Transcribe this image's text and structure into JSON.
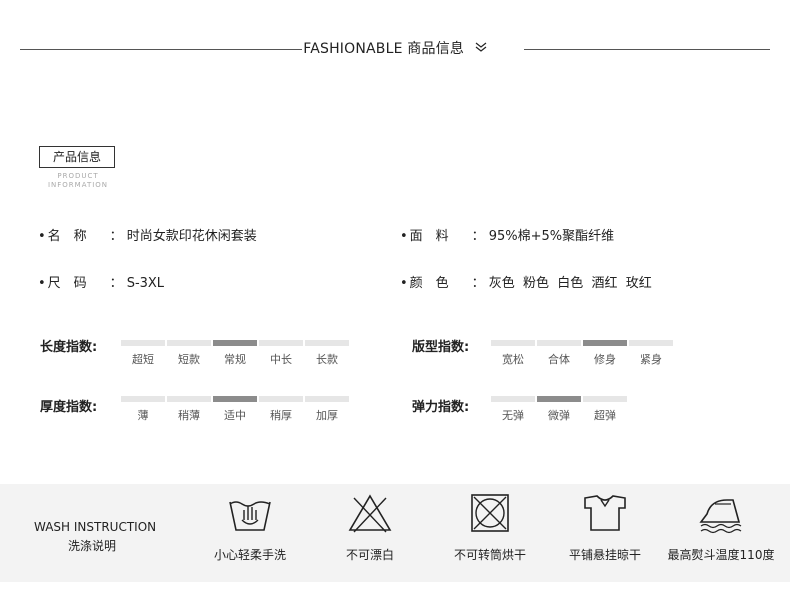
{
  "header": {
    "title": "FASHIONABLE 商品信息",
    "icon": "double-chevron-down-icon"
  },
  "badge": {
    "label": "产品信息",
    "en_line1": "PRODUCT",
    "en_line2": "INFORMATION"
  },
  "info": {
    "name": {
      "key": "名　称",
      "sep": "：",
      "value": "时尚女款印花休闲套装"
    },
    "material": {
      "key": "面　料",
      "sep": "：",
      "value": "95%棉+5%聚酯纤维"
    },
    "size": {
      "key": "尺　码",
      "sep": "：",
      "value": "S-3XL"
    },
    "color": {
      "key": "颜　色",
      "sep": "：",
      "value": "灰色  粉色  白色  酒红  玫红"
    }
  },
  "scales": {
    "length": {
      "title": "长度指数:",
      "options": [
        "超短",
        "短款",
        "常规",
        "中长",
        "长款"
      ],
      "selected": 2
    },
    "fit": {
      "title": "版型指数:",
      "options": [
        "宽松",
        "合体",
        "修身",
        "紧身"
      ],
      "selected": 2
    },
    "thickness": {
      "title": "厚度指数:",
      "options": [
        "薄",
        "稍薄",
        "适中",
        "稍厚",
        "加厚"
      ],
      "selected": 2
    },
    "elasticity": {
      "title": "弹力指数:",
      "options": [
        "无弹",
        "微弹",
        "超弹"
      ],
      "selected": 1
    }
  },
  "wash": {
    "title": "WASH INSTRUCTION",
    "subtitle": "洗涤说明",
    "items": [
      {
        "icon": "hand-wash-icon",
        "label": "小心轻柔手洗"
      },
      {
        "icon": "no-bleach-icon",
        "label": "不可漂白"
      },
      {
        "icon": "no-tumble-dry-icon",
        "label": "不可转筒烘干"
      },
      {
        "icon": "hang-dry-icon",
        "label": "平铺悬挂晾干"
      },
      {
        "icon": "iron-icon",
        "label": "最高熨斗温度110度"
      }
    ]
  },
  "colors": {
    "text": "#222222",
    "bar_active": "#8c8c8c",
    "bar_inactive": "#e6e6e6",
    "wash_bg": "#f3f3f3"
  }
}
